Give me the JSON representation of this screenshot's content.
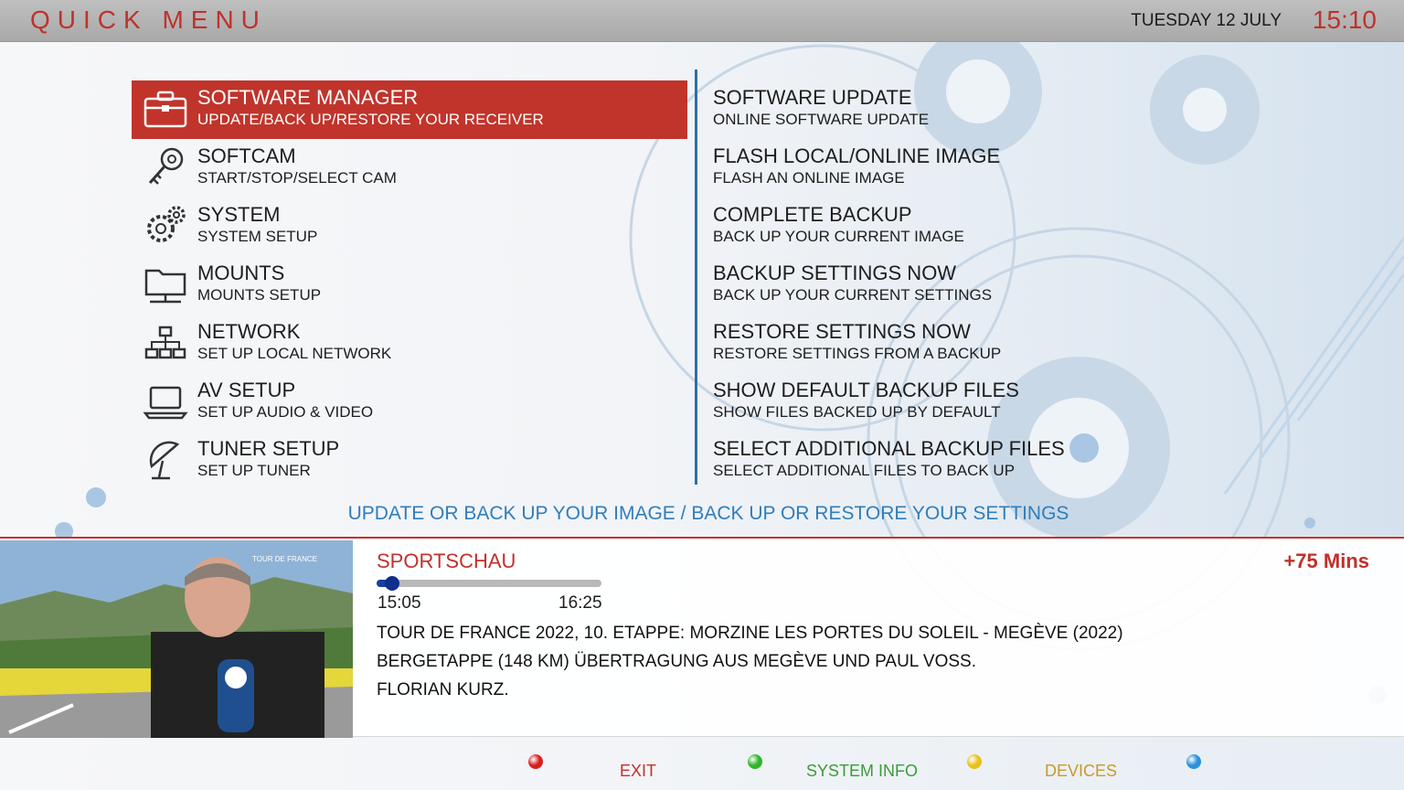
{
  "header": {
    "title": "QUICK MENU",
    "date": "TUESDAY 12 JULY",
    "time": "15:10"
  },
  "menu": {
    "items": [
      {
        "title": "SOFTWARE MANAGER",
        "subtitle": "UPDATE/BACK UP/RESTORE YOUR RECEIVER",
        "icon": "toolbox-icon",
        "selected": true
      },
      {
        "title": "SOFTCAM",
        "subtitle": "START/STOP/SELECT CAM",
        "icon": "key-icon",
        "selected": false
      },
      {
        "title": "SYSTEM",
        "subtitle": "SYSTEM SETUP",
        "icon": "gears-icon",
        "selected": false
      },
      {
        "title": "MOUNTS",
        "subtitle": "MOUNTS SETUP",
        "icon": "network-folder-icon",
        "selected": false
      },
      {
        "title": "NETWORK",
        "subtitle": "SET UP LOCAL NETWORK",
        "icon": "network-icon",
        "selected": false
      },
      {
        "title": "AV SETUP",
        "subtitle": "SET UP AUDIO & VIDEO",
        "icon": "laptop-icon",
        "selected": false
      },
      {
        "title": "TUNER SETUP",
        "subtitle": "SET UP TUNER",
        "icon": "satellite-dish-icon",
        "selected": false
      }
    ]
  },
  "submenu": {
    "items": [
      {
        "title": "SOFTWARE UPDATE",
        "subtitle": "ONLINE SOFTWARE UPDATE"
      },
      {
        "title": "FLASH LOCAL/ONLINE IMAGE",
        "subtitle": "FLASH AN ONLINE IMAGE"
      },
      {
        "title": "COMPLETE BACKUP",
        "subtitle": "BACK UP YOUR CURRENT IMAGE"
      },
      {
        "title": "BACKUP SETTINGS NOW",
        "subtitle": "BACK UP YOUR CURRENT SETTINGS"
      },
      {
        "title": "RESTORE SETTINGS NOW",
        "subtitle": "RESTORE SETTINGS FROM A BACKUP"
      },
      {
        "title": "SHOW DEFAULT BACKUP FILES",
        "subtitle": "SHOW FILES BACKED UP BY DEFAULT"
      },
      {
        "title": "SELECT ADDITIONAL BACKUP FILES",
        "subtitle": "SELECT ADDITIONAL FILES TO BACK UP"
      }
    ]
  },
  "description": "UPDATE OR BACK UP YOUR IMAGE / BACK UP OR RESTORE YOUR SETTINGS",
  "now_playing": {
    "channel": "SPORTSCHAU",
    "remaining": "+75 Mins",
    "start": "15:05",
    "end": "16:25",
    "progress_fraction": 0.06,
    "preview_overlay": "TOUR DE FRANCE",
    "epg": [
      "TOUR DE FRANCE 2022, 10. ETAPPE: MORZINE LES PORTES DU SOLEIL - MEGÈVE (2022)",
      "BERGETAPPE (148 KM) ÜBERTRAGUNG AUS MEGÈVE UND PAUL VOSS.",
      "FLORIAN KURZ."
    ]
  },
  "footer": {
    "buttons": [
      {
        "color": "red",
        "label": "EXIT",
        "dot": "#d9201f",
        "text_color": "#c0312b"
      },
      {
        "color": "green",
        "label": "SYSTEM INFO",
        "dot": "#2fb52b",
        "text_color": "#3d9a3a"
      },
      {
        "color": "yellow",
        "label": "DEVICES",
        "dot": "#e8c21c",
        "text_color": "#c89a2a"
      },
      {
        "color": "blue",
        "label": "",
        "dot": "#2a8fe0",
        "text_color": "#2a8fe0"
      }
    ]
  },
  "colors": {
    "accent": "#c0312b",
    "selection": "#c0342b",
    "divider": "#2f6ea8",
    "description_text": "#2f7dbd"
  }
}
